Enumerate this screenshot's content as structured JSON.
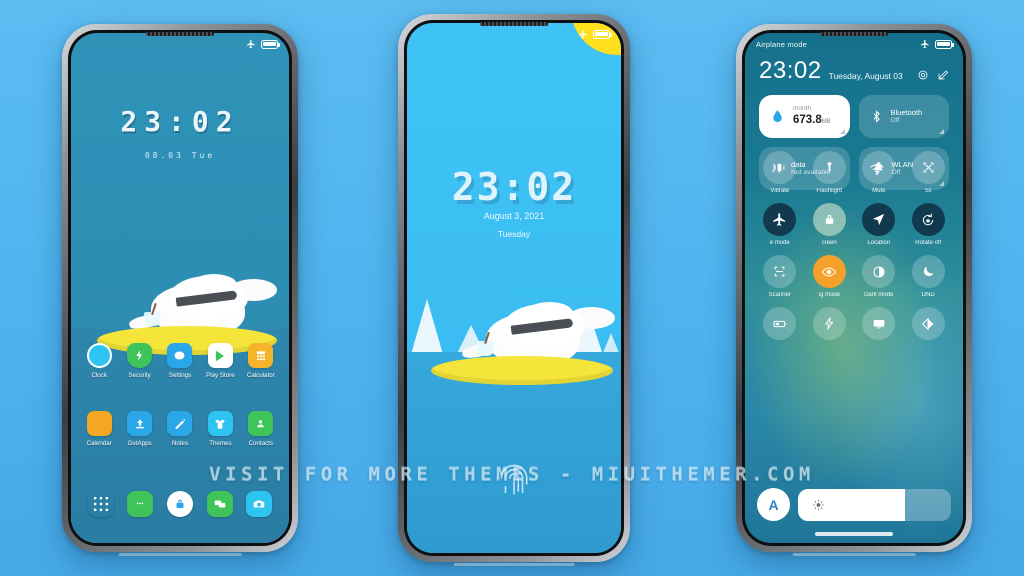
{
  "watermark": "VISIT FOR MORE THEMES - MIUITHEMER.COM",
  "theme": {
    "page_background": "#53b8f0",
    "home_sky": "#2d8eb4",
    "lock_sky": "#3bbdf2",
    "ring_yellow": "#f5e53a",
    "sun_yellow": "#ffe01f",
    "accent_orange": "#f5a02a",
    "cc_dark_tile": "#123a4e"
  },
  "phone1": {
    "name": "home-screen",
    "statusbar": {
      "left_text": "",
      "plane_icon": "airplane-icon",
      "battery_icon": "battery-icon"
    },
    "clock": "23:02",
    "date": "08.03   Tue",
    "apps_row1": [
      {
        "label": "Clock",
        "icon": "clock-icon",
        "color": "#2ec4f1"
      },
      {
        "label": "Security",
        "icon": "shield-icon",
        "color": "#3fc45a"
      },
      {
        "label": "Settings",
        "icon": "gear-icon",
        "color": "#2aa7e8"
      },
      {
        "label": "Play Store",
        "icon": "play-store-icon",
        "color": "#ffffff"
      },
      {
        "label": "Calculator",
        "icon": "calculator-icon",
        "color": "#f5b52a"
      }
    ],
    "apps_row2": [
      {
        "label": "Calendar",
        "icon": "calendar-icon",
        "color": "#f5a623"
      },
      {
        "label": "GetApps",
        "icon": "download-icon",
        "color": "#2aa7e8"
      },
      {
        "label": "Notes",
        "icon": "pencil-icon",
        "color": "#2aa7e8"
      },
      {
        "label": "Themes",
        "icon": "tshirt-icon",
        "color": "#2ec4f1"
      },
      {
        "label": "Contacts",
        "icon": "contacts-icon",
        "color": "#3fc45a"
      }
    ],
    "dock": [
      {
        "label": "App Drawer",
        "icon": "app-drawer-icon",
        "color": "#ffffff"
      },
      {
        "label": "Messaging",
        "icon": "message-icon",
        "color": "#3fc45a"
      },
      {
        "label": "Lock",
        "icon": "lock-icon",
        "color": "#ffffff"
      },
      {
        "label": "Chat",
        "icon": "chat-icon",
        "color": "#3fc45a"
      },
      {
        "label": "Camera",
        "icon": "camera-icon",
        "color": "#2ec4f1"
      }
    ]
  },
  "phone2": {
    "name": "lock-screen",
    "statusbar": {
      "plane_icon": "airplane-icon",
      "battery_icon": "battery-icon"
    },
    "clock": "23:02",
    "date": "August 3, 2021",
    "day": "Tuesday",
    "unlock_icon": "fingerprint-icon"
  },
  "phone3": {
    "name": "control-center",
    "status_label": "Airplane mode",
    "statusbar": {
      "plane_icon": "airplane-icon",
      "battery_icon": "battery-icon"
    },
    "time": "23:02",
    "date": "Tuesday, August 03",
    "header_icons": [
      {
        "name": "settings-gear-icon"
      },
      {
        "name": "edit-icon"
      }
    ],
    "big_tiles": [
      {
        "title": "month",
        "value": "673.8",
        "unit": "MB",
        "icon": "data-drop-icon",
        "style": "light"
      },
      {
        "title": "Bluetooth",
        "value": "Off",
        "unit": "",
        "icon": "bluetooth-icon",
        "style": "dim"
      },
      {
        "title": "data",
        "value": "Not available",
        "unit": "",
        "icon": "mobile-data-icon",
        "style": "dim"
      },
      {
        "title": "WLAN",
        "value": "Off",
        "unit": "",
        "icon": "wifi-icon",
        "style": "dim"
      }
    ],
    "toggles": [
      {
        "label": "Vibrate",
        "icon": "vibrate-icon",
        "state": "off"
      },
      {
        "label": "Flashlight",
        "icon": "flashlight-icon",
        "state": "off"
      },
      {
        "label": "Mute",
        "icon": "bell-icon",
        "state": "off"
      },
      {
        "label": "Sc",
        "icon": "screenshot-icon",
        "state": "off"
      },
      {
        "label": "e mode",
        "icon": "airplane-icon",
        "state": "on-dark"
      },
      {
        "label": "creen",
        "icon": "padlock-icon",
        "state": "on-light"
      },
      {
        "label": "Location",
        "icon": "location-icon",
        "state": "on-dark"
      },
      {
        "label": "Rotate off",
        "icon": "rotate-lock-icon",
        "state": "on-dark"
      },
      {
        "label": "Scanner",
        "icon": "scanner-icon",
        "state": "off"
      },
      {
        "label": "ıg mode",
        "icon": "eye-icon",
        "state": "on-orange"
      },
      {
        "label": "Dark mode",
        "icon": "contrast-icon",
        "state": "off"
      },
      {
        "label": "DND",
        "icon": "moon-icon",
        "state": "off"
      },
      {
        "label": "",
        "icon": "battery-saver-icon",
        "state": "off"
      },
      {
        "label": "",
        "icon": "lightning-icon",
        "state": "off"
      },
      {
        "label": "",
        "icon": "cast-icon",
        "state": "off"
      },
      {
        "label": "",
        "icon": "reading-contrast-icon",
        "state": "off"
      }
    ],
    "brightness": {
      "auto_label": "A",
      "icon": "sun-icon",
      "percent": 70
    }
  }
}
